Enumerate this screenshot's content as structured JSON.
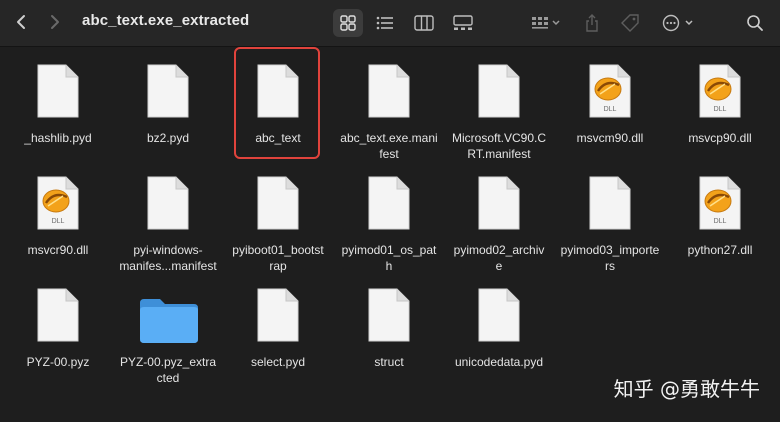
{
  "window": {
    "title": "abc_text.exe_extracted"
  },
  "toolbar": {
    "back_icon": "chevron-left-icon",
    "forward_icon": "chevron-right-icon",
    "views": [
      "icon-view",
      "list-view",
      "column-view",
      "gallery-view"
    ],
    "active_view": "icon-view"
  },
  "files": [
    {
      "name": "_hashlib.pyd",
      "kind": "document"
    },
    {
      "name": "bz2.pyd",
      "kind": "document"
    },
    {
      "name": "abc_text",
      "kind": "document",
      "selected": true
    },
    {
      "name": "abc_text.exe.mani\nfest",
      "kind": "document"
    },
    {
      "name": "Microsoft.VC90.C\nRT.manifest",
      "kind": "document"
    },
    {
      "name": "msvcm90.dll",
      "kind": "dll"
    },
    {
      "name": "msvcp90.dll",
      "kind": "dll"
    },
    {
      "name": "msvcr90.dll",
      "kind": "dll"
    },
    {
      "name": "pyi-windows-\nmanifes...manifest",
      "kind": "document"
    },
    {
      "name": "pyiboot01_bootst\nrap",
      "kind": "document"
    },
    {
      "name": "pyimod01_os_pat\nh",
      "kind": "document"
    },
    {
      "name": "pyimod02_archiv\ne",
      "kind": "document"
    },
    {
      "name": "pyimod03_importe\nrs",
      "kind": "document"
    },
    {
      "name": "python27.dll",
      "kind": "dll"
    },
    {
      "name": "PYZ-00.pyz",
      "kind": "document"
    },
    {
      "name": "PYZ-00.pyz_extra\ncted",
      "kind": "folder"
    },
    {
      "name": "select.pyd",
      "kind": "document"
    },
    {
      "name": "struct",
      "kind": "document"
    },
    {
      "name": "unicodedata.pyd",
      "kind": "document"
    }
  ],
  "dll_badge": "DLL",
  "watermark": "知乎 @勇敢牛牛",
  "colors": {
    "background": "#1e1e1e",
    "selection_border": "#e0433c",
    "folder_blue": "#5aaef5"
  }
}
